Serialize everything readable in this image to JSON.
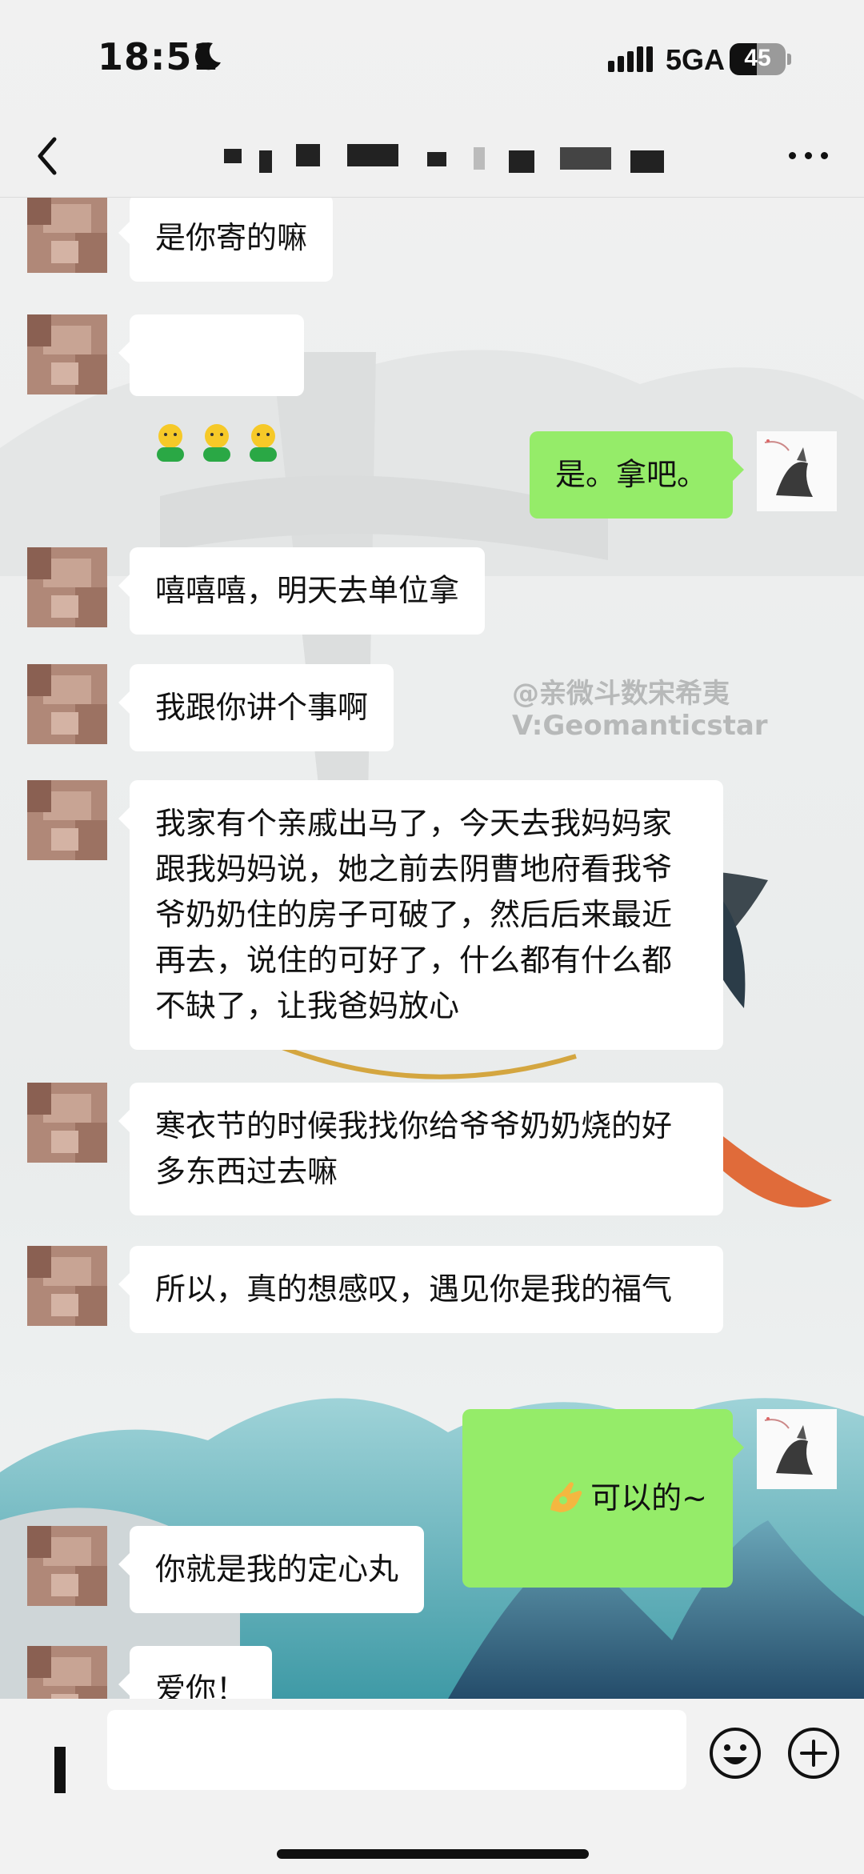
{
  "status_bar": {
    "time": "18:51",
    "network": "5GA",
    "battery": "45"
  },
  "header": {
    "title_obscured": true
  },
  "messages": [
    {
      "side": "in",
      "text": "是你寄的嘛"
    },
    {
      "side": "in",
      "type": "emoji",
      "emoji": [
        "🙂",
        "🙂",
        "🙂"
      ]
    },
    {
      "side": "out",
      "text": "是。拿吧。"
    },
    {
      "side": "in",
      "text": "嘻嘻嘻，明天去单位拿"
    },
    {
      "side": "in",
      "text": "我跟你讲个事啊"
    },
    {
      "side": "in",
      "text": "我家有个亲戚出马了，今天去我妈妈家跟我妈妈说，她之前去阴曹地府看我爷爷奶奶住的房子可破了，然后后来最近再去，说住的可好了，什么都有什么都不缺了，让我爸妈放心"
    },
    {
      "side": "in",
      "text": "寒衣节的时候我找你给爷爷奶奶烧的好多东西过去嘛"
    },
    {
      "side": "in",
      "text": "所以，真的想感叹，遇见你是我的福气"
    },
    {
      "side": "out",
      "text": "可以的~",
      "icon": "ok-hand-icon"
    },
    {
      "side": "in",
      "text": "你就是我的定心丸"
    },
    {
      "side": "in",
      "text": "爱你！"
    }
  ],
  "watermark": {
    "line1": "@亲微斗数宋希夷",
    "line2": "V:Geomanticstar"
  },
  "input": {
    "placeholder": ""
  },
  "colors": {
    "outgoing_bubble": "#95ec69",
    "incoming_bubble": "#ffffff"
  }
}
